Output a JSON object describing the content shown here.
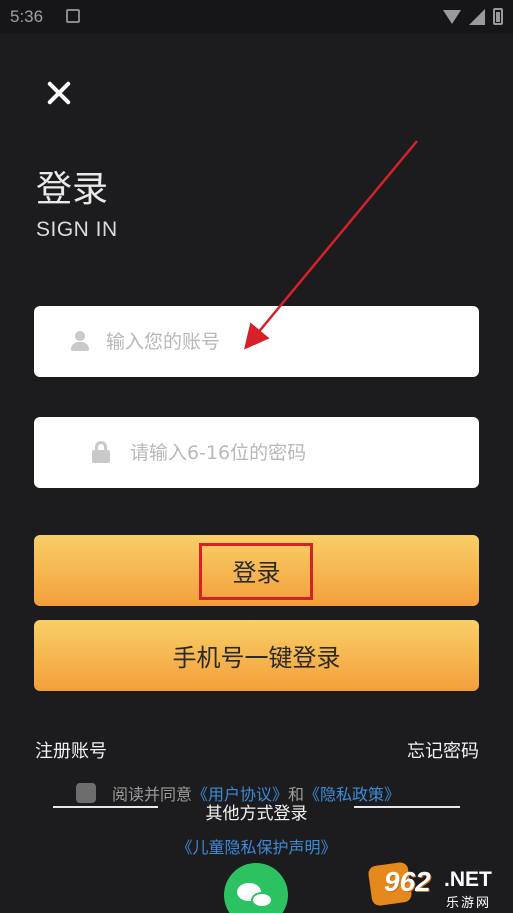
{
  "status_bar": {
    "time": "5:36"
  },
  "header": {
    "close_label": "×"
  },
  "title": "登录",
  "subtitle": "SIGN IN",
  "account_field": {
    "placeholder": "输入您的账号",
    "value": ""
  },
  "password_field": {
    "placeholder": "请输入6-16位的密码",
    "value": ""
  },
  "login_button": "登录",
  "phone_login_button": "手机号一键登录",
  "register_link": "注册账号",
  "forgot_link": "忘记密码",
  "agreement": {
    "prefix": "阅读并同意",
    "user_agreement": "《用户协议》",
    "and": "和",
    "privacy_policy": "《隐私政策》",
    "checked": false
  },
  "other_login_label": "其他方式登录",
  "child_privacy_link": "《儿童隐私保护声明》",
  "social": [
    {
      "name": "wechat",
      "icon": "wechat-icon",
      "color": "#2dc261"
    }
  ],
  "watermark": {
    "number": "962",
    "domain": ".NET",
    "site": "乐游网"
  },
  "colors": {
    "background": "#1c1c1e",
    "button_top": "#f9cf67",
    "button_bottom": "#f39f3b",
    "link_blue": "#3d8bd8",
    "annotation_red": "#d6202a"
  }
}
